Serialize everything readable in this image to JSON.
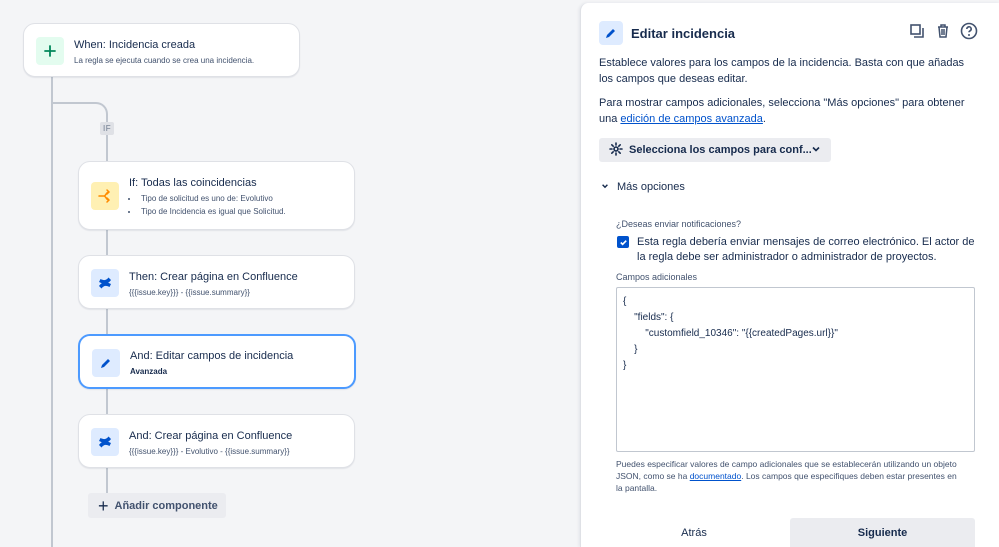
{
  "flow": {
    "trigger": {
      "title": "When: Incidencia creada",
      "subtitle": "La regla se ejecuta cuando se crea una incidencia."
    },
    "if_tag": "IF",
    "condition": {
      "title": "If: Todas las coincidencias",
      "items": [
        "Tipo de solicitud es uno de: Evolutivo",
        "Tipo de Incidencia es igual que Solicitud."
      ]
    },
    "actions": [
      {
        "title": "Then: Crear página en Confluence",
        "subtitle": "{{{issue.key}}} - {{issue.summary}}"
      },
      {
        "title": "And: Editar campos de incidencia",
        "subtitle": "Avanzada"
      },
      {
        "title": "And: Crear página en Confluence",
        "subtitle": "{{{issue.key}}} - Evolutivo - {{issue.summary}}"
      }
    ],
    "add_component": "Añadir componente"
  },
  "panel": {
    "title": "Editar incidencia",
    "intro": "Establece valores para los campos de la incidencia. Basta con que añadas los campos que deseas editar.",
    "more_fields_text": "Para mostrar campos adicionales, selecciona \"Más opciones\" para obtener una",
    "advanced_link": "edición de campos avanzada",
    "period": ".",
    "select_fields": "Selecciona los campos para conf...",
    "more_options": "Más opciones",
    "notify_label": "¿Deseas enviar notificaciones?",
    "notify_text": "Esta regla debería enviar mensajes de correo electrónico. El actor de la regla debe ser administrador o administrador de proyectos.",
    "additional_fields_label": "Campos adicionales",
    "json_value": "{\n    \"fields\": {\n        \"customfield_10346\": \"{{createdPages.url}}\"\n    }\n}",
    "help_before": "Puedes especificar valores de campo adicionales que se establecerán utilizando un objeto JSON, como se ha ",
    "help_link": "documentado",
    "help_after": ". Los campos que especifiques deben estar presentes en la pantalla.",
    "back": "Atrás",
    "next": "Siguiente"
  },
  "colors": {
    "accent": "#0052cc",
    "active_border": "#4c9aff",
    "trigger_icon_bg": "#e3fcef",
    "condition_icon_bg": "#fff0b3"
  }
}
